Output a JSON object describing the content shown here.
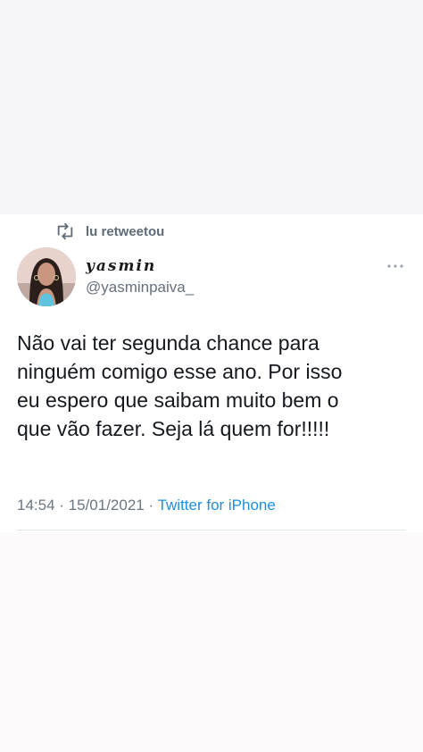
{
  "retweet": {
    "label": "lu retweetou",
    "icon": "retweet-icon"
  },
  "author": {
    "display_name": "yasmin",
    "handle": "@yasminpaiva_",
    "avatar": "avatar-photo"
  },
  "tweet": {
    "lines": [
      "Não vai ter segunda chance para",
      "ninguém comigo esse ano. Por isso",
      "eu espero que saibam muito bem o",
      "que vão fazer. Seja lá quem for!!!!!"
    ]
  },
  "meta": {
    "time": "14:54",
    "separator": " · ",
    "date": "15/01/2021",
    "source": "Twitter for iPhone"
  },
  "colors": {
    "link": "#1d8fdc",
    "muted": "#66707c",
    "text": "#15191d"
  },
  "icons": {
    "more": "more-dots-icon"
  }
}
